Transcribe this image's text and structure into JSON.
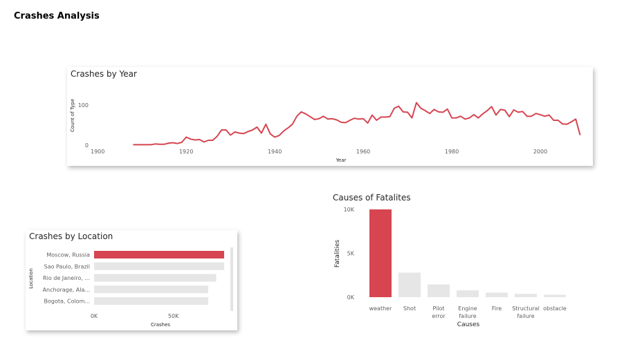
{
  "page": {
    "title": "Crashes Analysis"
  },
  "colors": {
    "accent": "#d64550",
    "inactive": "#e6e6e6",
    "line": "#d64550"
  },
  "chart_data": [
    {
      "type": "line",
      "title": "Crashes by Year",
      "xlabel": "Year",
      "ylabel": "Count of Type",
      "xlim": [
        1897,
        2010
      ],
      "ylim": [
        0,
        100
      ],
      "xticks": [
        1900,
        1920,
        1940,
        1960,
        1980,
        2000
      ],
      "xtick_labels": [
        "1900",
        "1920",
        "1940",
        "1960",
        "1980",
        "2000"
      ],
      "yticks": [
        0,
        100
      ],
      "ytick_labels": [
        "0",
        "100"
      ],
      "grid": false,
      "series": [
        {
          "x": [
            1908,
            1909,
            1910,
            1911,
            1912,
            1913,
            1914,
            1915,
            1916,
            1917,
            1918,
            1919,
            1920,
            1921,
            1922,
            1923,
            1924,
            1925,
            1926,
            1927,
            1928,
            1929,
            1930,
            1931,
            1932,
            1933,
            1934,
            1935,
            1936,
            1937,
            1938,
            1939,
            1940,
            1941,
            1942,
            1943,
            1944,
            1945,
            1946,
            1947,
            1948,
            1949,
            1950,
            1951,
            1952,
            1953,
            1954,
            1955,
            1956,
            1957,
            1958,
            1959,
            1960,
            1961,
            1962,
            1963,
            1964,
            1965,
            1966,
            1967,
            1968,
            1969,
            1970,
            1971,
            1972,
            1973,
            1974,
            1975,
            1976,
            1977,
            1978,
            1979,
            1980,
            1981,
            1982,
            1983,
            1984,
            1985,
            1986,
            1987,
            1988,
            1989,
            1990,
            1991,
            1992,
            1993,
            1994,
            1995,
            1996,
            1997,
            1998,
            1999,
            2000,
            2001,
            2002,
            2003,
            2004,
            2005,
            2006,
            2007,
            2008,
            2009
          ],
          "values": [
            1,
            1,
            1,
            1,
            1,
            3,
            2,
            2,
            5,
            6,
            4,
            7,
            20,
            15,
            13,
            14,
            8,
            12,
            12,
            22,
            38,
            38,
            25,
            33,
            30,
            29,
            34,
            38,
            45,
            30,
            52,
            28,
            20,
            24,
            35,
            43,
            52,
            72,
            83,
            78,
            71,
            64,
            66,
            72,
            65,
            66,
            63,
            57,
            56,
            62,
            67,
            65,
            66,
            55,
            75,
            62,
            70,
            70,
            71,
            92,
            97,
            83,
            82,
            68,
            106,
            92,
            86,
            79,
            89,
            83,
            82,
            90,
            68,
            68,
            72,
            65,
            68,
            76,
            68,
            78,
            86,
            96,
            75,
            89,
            87,
            71,
            88,
            82,
            84,
            72,
            72,
            79,
            76,
            72,
            75,
            62,
            62,
            53,
            52,
            58,
            65,
            25
          ]
        }
      ]
    },
    {
      "type": "bar",
      "orientation": "horizontal",
      "title": "Crashes by Location",
      "xlabel": "Crashes",
      "ylabel": "Location",
      "categories": [
        "Moscow, Russia",
        "Sao Paulo, Brazil",
        "Rio de Janeiro, ...",
        "Anchorage, Ala...",
        "Bogota, Colom..."
      ],
      "values": [
        82,
        82,
        77,
        72,
        72
      ],
      "xlim": [
        0,
        82
      ],
      "xticks": [
        0,
        50
      ],
      "xtick_labels": [
        "0K",
        "50K"
      ],
      "highlighted_index": 0,
      "grid": false
    },
    {
      "type": "bar",
      "title": "Causes of Fatalites",
      "xlabel": "Causes",
      "ylabel": "Fatalities",
      "categories": [
        "weather",
        "Shot",
        "Pilot error",
        "Engine failure",
        "Fire",
        "Structural failure",
        "obstacle"
      ],
      "category_lines": [
        [
          "weather"
        ],
        [
          "Shot"
        ],
        [
          "Pilot",
          "error"
        ],
        [
          "Engine",
          "failure"
        ],
        [
          "Fire"
        ],
        [
          "Structural",
          "failure"
        ],
        [
          "obstacle"
        ]
      ],
      "values": [
        10000,
        2800,
        1450,
        780,
        520,
        380,
        280
      ],
      "ylim": [
        0,
        10000
      ],
      "yticks": [
        0,
        5000,
        10000
      ],
      "ytick_labels": [
        "0K",
        "5K",
        "10K"
      ],
      "highlighted_index": 0,
      "grid": false
    }
  ]
}
